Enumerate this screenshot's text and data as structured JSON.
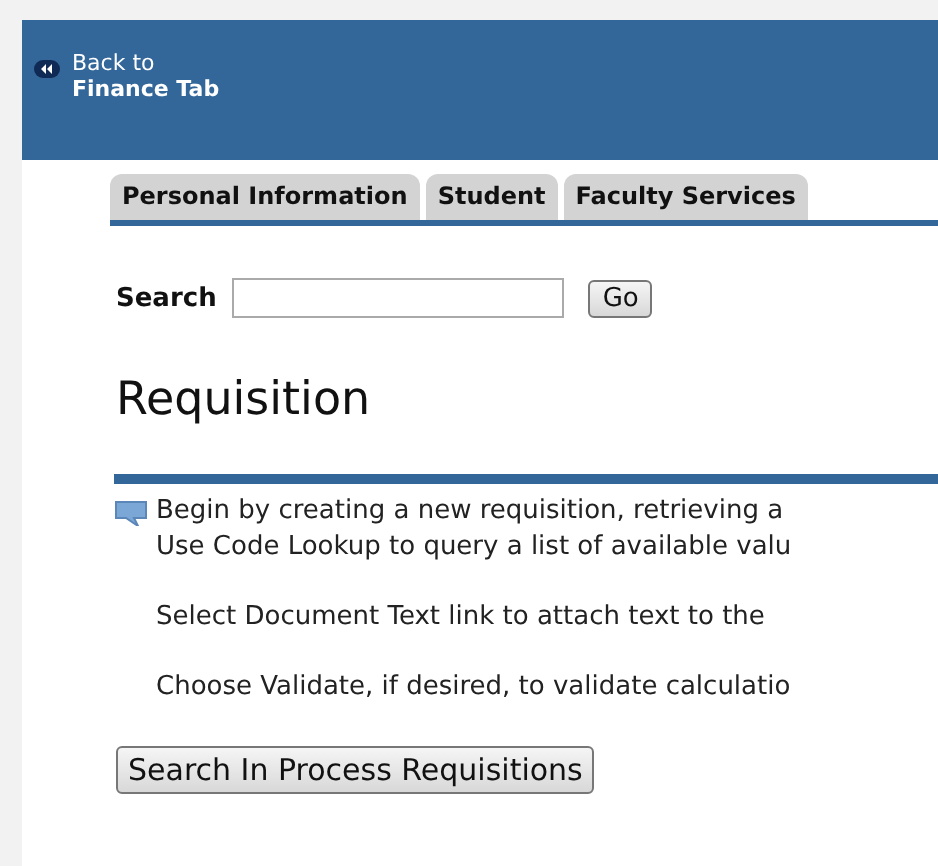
{
  "header": {
    "back_link": {
      "line_1": "Back to",
      "line_2": "Finance Tab"
    }
  },
  "tabs": [
    {
      "label": "Personal Information",
      "selected": false
    },
    {
      "label": "Student",
      "selected": false
    },
    {
      "label": "Faculty Services",
      "selected": false
    }
  ],
  "search": {
    "label": "Search",
    "button": "Go"
  },
  "page_title": "Requisition",
  "info": {
    "paragraphs": [
      "Begin by creating a new requisition, retrieving a",
      "Use Code Lookup to query a list of available valu",
      "Select Document Text link to attach text to the",
      "Choose Validate, if desired, to validate calculatio"
    ]
  },
  "buttons": [
    "Search In Process Requisitions"
  ]
}
